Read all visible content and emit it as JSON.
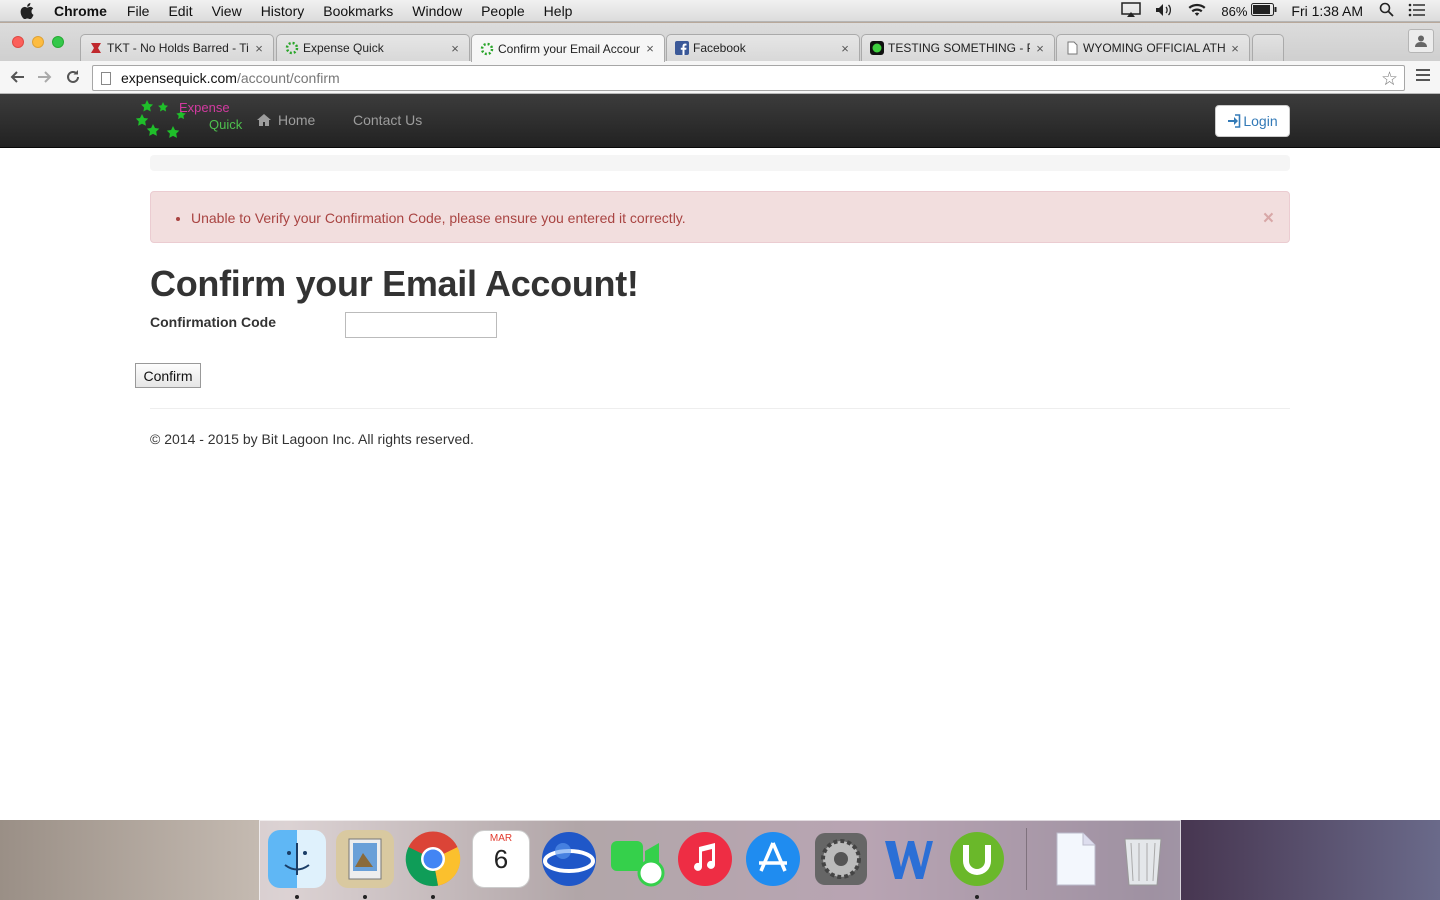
{
  "menubar": {
    "app_name": "Chrome",
    "items": [
      "File",
      "Edit",
      "View",
      "History",
      "Bookmarks",
      "Window",
      "People",
      "Help"
    ],
    "battery": "86%",
    "clock": "Fri 1:38 AM"
  },
  "browser": {
    "tabs": [
      {
        "title": "TKT - No Holds Barred - Ti"
      },
      {
        "title": "Expense Quick"
      },
      {
        "title": "Confirm your Email Accoun"
      },
      {
        "title": "Facebook"
      },
      {
        "title": "TESTING SOMETHING - P"
      },
      {
        "title": "WYOMING OFFICIAL ATHL"
      }
    ],
    "close_glyph": "×",
    "url_host": "expensequick.com",
    "url_path": "/account/confirm"
  },
  "site": {
    "brand_line1": "Expense",
    "brand_line2": "Quick",
    "nav_home": "Home",
    "nav_contact": "Contact Us",
    "login_label": "Login"
  },
  "alert": {
    "message": "Unable to Verify your Confirmation Code, please ensure you entered it correctly.",
    "close_glyph": "×"
  },
  "form": {
    "title": "Confirm your Email Account!",
    "code_label": "Confirmation Code",
    "code_value": "",
    "submit_label": "Confirm"
  },
  "footer": {
    "text": "© 2014 - 2015 by Bit Lagoon Inc. All rights reserved."
  },
  "dock": {
    "calendar_month": "MAR",
    "calendar_day": "6",
    "icons": [
      "finder-icon",
      "preview-icon",
      "chrome-icon",
      "calendar-icon",
      "google-earth-icon",
      "facetime-icon",
      "itunes-icon",
      "app-store-icon",
      "system-preferences-icon",
      "word-icon",
      "utorrent-icon",
      "documents-icon",
      "trash-icon"
    ]
  },
  "colors": {
    "navbar": "#222222",
    "alert_bg": "#f2dede",
    "alert_text": "#a94442",
    "link": "#337ab7"
  }
}
